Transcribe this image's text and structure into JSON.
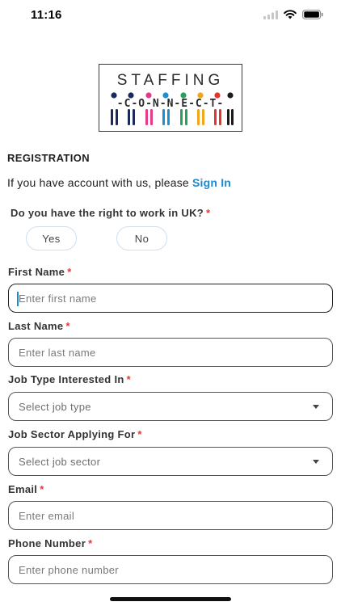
{
  "status_bar": {
    "time": "11:16"
  },
  "logo": {
    "word": "STAFFING",
    "sub": "-C-O-N-N-E-C-T-",
    "colors": [
      "#1b2a5c",
      "#1b2a5c",
      "#e53a8c",
      "#1f8fd0",
      "#2aa05a",
      "#f2a51c",
      "#e3342f",
      "#1b1b1b"
    ]
  },
  "page": {
    "heading": "REGISTRATION",
    "signin_prefix": "If you have account with us, please ",
    "signin_link": "Sign In"
  },
  "right_to_work": {
    "question": "Do you have the right to work in UK?",
    "required": "*",
    "options": [
      "Yes",
      "No"
    ]
  },
  "fields": {
    "first_name": {
      "label": "First Name",
      "required": "*",
      "placeholder": "Enter first name"
    },
    "last_name": {
      "label": "Last Name",
      "required": "*",
      "placeholder": "Enter last name"
    },
    "job_type": {
      "label": "Job Type Interested In",
      "required": "*",
      "placeholder": "Select job type"
    },
    "job_sector": {
      "label": "Job Sector Applying For",
      "required": "*",
      "placeholder": "Select job sector"
    },
    "email": {
      "label": "Email",
      "required": "*",
      "placeholder": "Enter email"
    },
    "phone": {
      "label": "Phone Number",
      "required": "*",
      "placeholder": "Enter phone number"
    }
  },
  "colors": {
    "link": "#1e88d0",
    "required": "#e53935",
    "caret": "#1e88d0"
  }
}
